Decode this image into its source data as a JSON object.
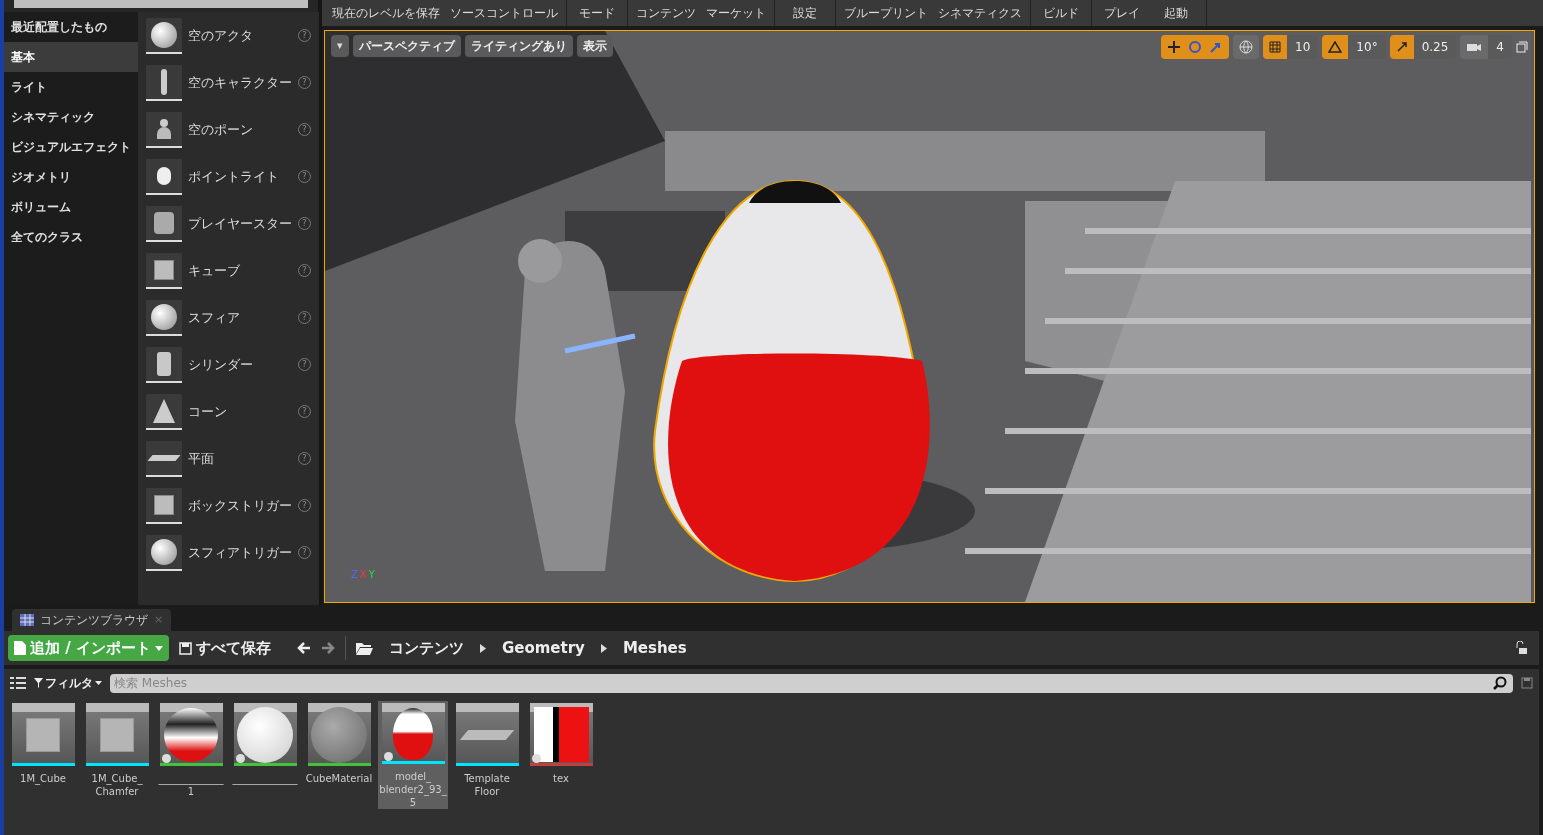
{
  "categories": [
    {
      "label": "最近配置したもの",
      "selected": false
    },
    {
      "label": "基本",
      "selected": true
    },
    {
      "label": "ライト",
      "selected": false
    },
    {
      "label": "シネマティック",
      "selected": false
    },
    {
      "label": "ビジュアルエフェクト",
      "selected": false
    },
    {
      "label": "ジオメトリ",
      "selected": false
    },
    {
      "label": "ボリューム",
      "selected": false
    },
    {
      "label": "全てのクラス",
      "selected": false
    }
  ],
  "place_items": [
    {
      "label": "空のアクタ",
      "kind": "sphere"
    },
    {
      "label": "空のキャラクター",
      "kind": "figure"
    },
    {
      "label": "空のポーン",
      "kind": "pawn"
    },
    {
      "label": "ポイントライト",
      "kind": "bulb"
    },
    {
      "label": "プレイヤースター",
      "kind": "start"
    },
    {
      "label": "キューブ",
      "kind": "cube"
    },
    {
      "label": "スフィア",
      "kind": "sphere"
    },
    {
      "label": "シリンダー",
      "kind": "cylinder"
    },
    {
      "label": "コーン",
      "kind": "cone"
    },
    {
      "label": "平面",
      "kind": "plane"
    },
    {
      "label": "ボックストリガー",
      "kind": "cube"
    },
    {
      "label": "スフィアトリガー",
      "kind": "sphere"
    }
  ],
  "help_glyph": "?",
  "toolbar": {
    "groups": [
      [
        "現在のレベルを保存",
        "ソースコントロール"
      ],
      [
        "モード"
      ],
      [
        "コンテンツ",
        "マーケット"
      ],
      [
        "設定"
      ],
      [
        "ブループリント",
        "シネマティクス"
      ],
      [
        "ビルド"
      ],
      [
        "プレイ",
        "起動"
      ]
    ]
  },
  "viewport": {
    "menu_caret": "▾",
    "buttons": [
      "パースペクティブ",
      "ライティングあり",
      "表示"
    ],
    "snap": [
      {
        "kind": "icons",
        "active": true
      },
      {
        "kind": "world",
        "active": false
      },
      {
        "kind": "grid",
        "value": "10",
        "active": true
      },
      {
        "kind": "rotate",
        "value": "10°",
        "active": true
      },
      {
        "kind": "scale",
        "value": "0.25",
        "active": true
      },
      {
        "kind": "speed",
        "value": "4",
        "active": false
      }
    ],
    "axes": {
      "z": "Z",
      "x": "X",
      "y": "Y"
    }
  },
  "content_browser": {
    "tab": "コンテンツブラウザ",
    "tab_close": "×",
    "add_button": "追加 / インポート",
    "save_all": "すべて保存",
    "path": [
      "コンテンツ",
      "Geometry",
      "Meshes"
    ],
    "filter": "フィルタ",
    "search": {
      "placeholder": "検索 Meshes"
    },
    "assets": [
      {
        "name": "1M_Cube",
        "kind": "cube",
        "color": "#00e5ff",
        "starred": false,
        "selected": false
      },
      {
        "name": "1M_Cube_Chamfer",
        "kind": "cube",
        "color": "#00e5ff",
        "starred": false,
        "selected": false
      },
      {
        "name": "_____________1",
        "kind": "ball",
        "color": "#44c23a",
        "starred": true,
        "selected": false
      },
      {
        "name": "_____________",
        "kind": "white",
        "color": "#44c23a",
        "starred": true,
        "selected": false
      },
      {
        "name": "CubeMaterial",
        "kind": "grey",
        "color": "#44c23a",
        "starred": false,
        "selected": false
      },
      {
        "name": "model_blender2_93_5",
        "kind": "doll",
        "color": "#00e5ff",
        "starred": true,
        "selected": true
      },
      {
        "name": "Template Floor",
        "kind": "plane",
        "color": "#00e5ff",
        "starred": false,
        "selected": false
      },
      {
        "name": "tex",
        "kind": "texture",
        "color": "#c04040",
        "starred": true,
        "selected": false
      }
    ]
  }
}
